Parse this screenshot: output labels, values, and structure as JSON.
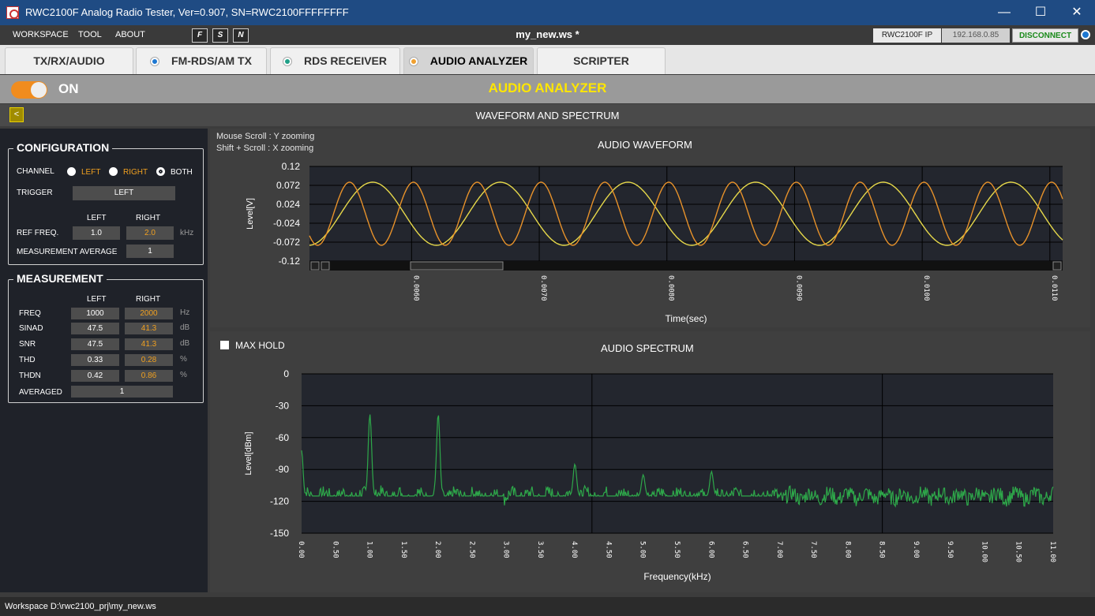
{
  "window": {
    "title": "RWC2100F Analog Radio Tester, Ver=0.907, SN=RWC2100FFFFFFFF"
  },
  "menu": {
    "items": [
      "WORKSPACE",
      "TOOL",
      "ABOUT"
    ],
    "workspace_name": "my_new.ws *",
    "toolbar_icons": [
      "F",
      "S",
      "N"
    ]
  },
  "connection": {
    "ip_label": "RWC2100F IP",
    "ip_value": "192.168.0.85",
    "disconnect": "DISCONNECT"
  },
  "tabs": [
    {
      "label": "TX/RX/AUDIO",
      "dot": ""
    },
    {
      "label": "FM-RDS/AM TX",
      "dot": "#1e78d2"
    },
    {
      "label": "RDS RECEIVER",
      "dot": "#20a088"
    },
    {
      "label": "AUDIO ANALYZER",
      "dot": "#f0a030"
    },
    {
      "label": "SCRIPTER",
      "dot": ""
    }
  ],
  "power": {
    "label": "ON",
    "page_title": "AUDIO ANALYZER"
  },
  "section": {
    "title": "WAVEFORM AND SPECTRUM",
    "back_glyph": "<"
  },
  "config": {
    "title": "CONFIGURATION",
    "channel_label": "CHANNEL",
    "channels": [
      "LEFT",
      "RIGHT",
      "BOTH"
    ],
    "trigger_label": "TRIGGER",
    "trigger_value": "LEFT",
    "col_left": "LEFT",
    "col_right": "RIGHT",
    "ref_freq_label": "REF FREQ.",
    "ref_left": "1.0",
    "ref_right": "2.0",
    "ref_unit": "kHz",
    "avg_label": "MEASUREMENT AVERAGE",
    "avg_value": "1"
  },
  "measurement": {
    "title": "MEASUREMENT",
    "col_left": "LEFT",
    "col_right": "RIGHT",
    "rows": [
      {
        "label": "FREQ",
        "left": "1000",
        "right": "2000",
        "unit": "Hz"
      },
      {
        "label": "SINAD",
        "left": "47.5",
        "right": "41.3",
        "unit": "dB"
      },
      {
        "label": "SNR",
        "left": "47.5",
        "right": "41.3",
        "unit": "dB"
      },
      {
        "label": "THD",
        "left": "0.33",
        "right": "0.28",
        "unit": "%"
      },
      {
        "label": "THDN",
        "left": "0.42",
        "right": "0.86",
        "unit": "%"
      }
    ],
    "averaged_label": "AVERAGED",
    "averaged_value": "1"
  },
  "waveform": {
    "hint1": "Mouse Scroll : Y zooming",
    "hint2": "Shift + Scroll : X zooming"
  },
  "spectrum": {
    "max_hold": "MAX HOLD"
  },
  "status": {
    "workspace": "Workspace  D:\\rwc2100_prj\\my_new.ws"
  },
  "chart_data": [
    {
      "type": "line",
      "title": "AUDIO WAVEFORM",
      "xlabel": "Time(sec)",
      "ylabel": "Level[V]",
      "xlim": [
        0.0052,
        0.0111
      ],
      "ylim": [
        -0.12,
        0.12
      ],
      "yticks": [
        "0.12",
        "0.072",
        "0.024",
        "-0.024",
        "-0.072",
        "-0.12"
      ],
      "xticks": [
        "0.0060",
        "0.0070",
        "0.0080",
        "0.0090",
        "0.0100",
        "0.0110"
      ],
      "series": [
        {
          "color": "#e6d84a",
          "amplitude": 0.08,
          "frequency_hz": 1000,
          "phase_deg": 200
        },
        {
          "color": "#e8922a",
          "amplitude": 0.08,
          "frequency_hz": 2000,
          "phase_deg": 80
        }
      ]
    },
    {
      "type": "line",
      "title": "AUDIO SPECTRUM",
      "xlabel": "Frequency(kHz)",
      "ylabel": "Level[dBm]",
      "xlim": [
        0,
        11
      ],
      "ylim": [
        -150,
        0
      ],
      "yticks": [
        "0",
        "-30",
        "-60",
        "-90",
        "-120",
        "-150"
      ],
      "xticks": [
        "0.00",
        "0.50",
        "1.00",
        "1.50",
        "2.00",
        "2.50",
        "3.00",
        "3.50",
        "4.00",
        "4.50",
        "5.00",
        "5.50",
        "6.00",
        "6.50",
        "7.00",
        "7.50",
        "8.00",
        "8.50",
        "9.00",
        "9.50",
        "10.00",
        "10.50",
        "11.00"
      ],
      "color": "#2ea84a",
      "noise_floor_dbm": -115,
      "peaks": [
        {
          "freq_khz": 0.0,
          "level_dbm": -72
        },
        {
          "freq_khz": 1.0,
          "level_dbm": -38
        },
        {
          "freq_khz": 2.0,
          "level_dbm": -38
        },
        {
          "freq_khz": 4.0,
          "level_dbm": -85
        },
        {
          "freq_khz": 5.0,
          "level_dbm": -95
        },
        {
          "freq_khz": 6.0,
          "level_dbm": -92
        }
      ]
    }
  ]
}
